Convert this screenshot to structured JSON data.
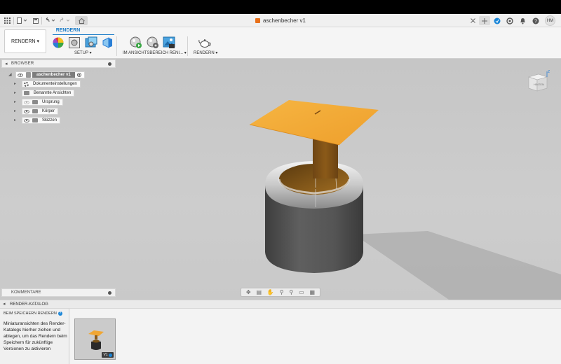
{
  "document": {
    "title": "aschenbecher v1"
  },
  "user": {
    "initials": "HM"
  },
  "toolbar": {
    "workspace_label": "RENDERN",
    "workspace_arrow": "▾",
    "tab_label": "RENDERN",
    "groups": {
      "setup": "SETUP",
      "in_canvas": "IM ANSICHTSBEREICH RENI...",
      "render": "RENDERN"
    },
    "dropdown_arrow": "▾"
  },
  "browser": {
    "title": "BROWSER",
    "root": "aschenbecher v1",
    "items": [
      {
        "label": "Dokumenteinstellungen",
        "icon": "gear-icon"
      },
      {
        "label": "Benannte Ansichten",
        "icon": "folder-icon"
      },
      {
        "label": "Ursprung",
        "icon": "folder-icon"
      },
      {
        "label": "Körper",
        "icon": "folder-icon"
      },
      {
        "label": "Skizzen",
        "icon": "folder-icon"
      }
    ]
  },
  "viewcube": {
    "face_label": "HINTEN",
    "axis_label": "Z"
  },
  "comments": {
    "title": "KOMMENTARE"
  },
  "catalog": {
    "title": "RENDER-KATALOG",
    "subtitle": "BEIM SPEICHERN RENDERN",
    "help": "?",
    "description": "Miniaturansichten des Render-Katalogs hierher ziehen und ablegen, um das Rendern beim Speichern für zukünftige Versionen zu aktivieren",
    "thumbnail_badge": "V1"
  },
  "colors": {
    "accent": "#1a7bc7",
    "plate": "#f0a633",
    "stem": "#8b5a18",
    "body": "#555555"
  }
}
